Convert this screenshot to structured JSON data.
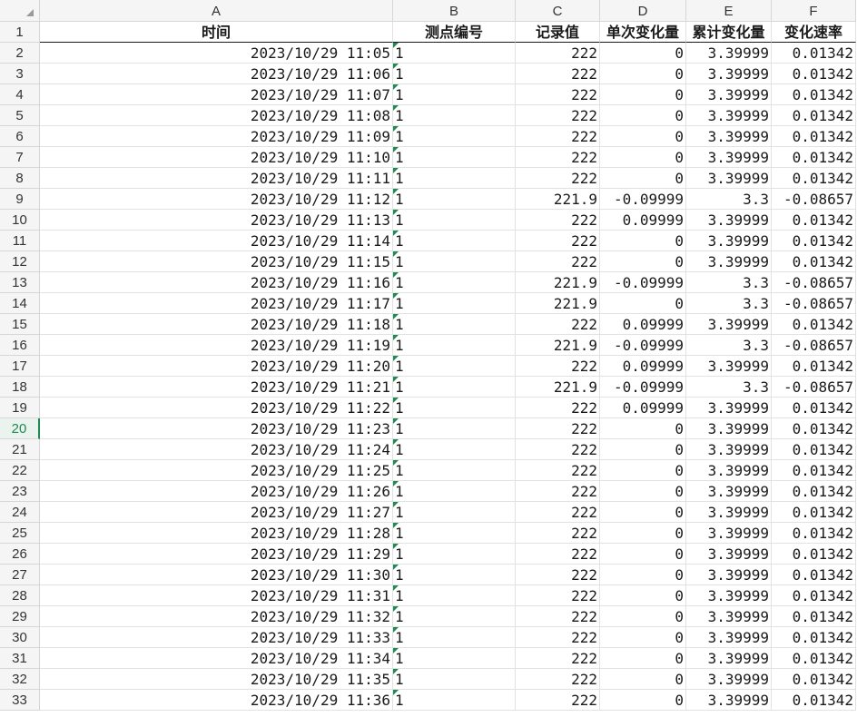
{
  "columns": [
    {
      "label": "A",
      "width": 389
    },
    {
      "label": "B",
      "width": 135
    },
    {
      "label": "C",
      "width": 93
    },
    {
      "label": "D",
      "width": 95
    },
    {
      "label": "E",
      "width": 94
    },
    {
      "label": "F",
      "width": 93
    }
  ],
  "active_row": 20,
  "header_row": [
    "时间",
    "测点编号",
    "记录值",
    "单次变化量",
    "累计变化量",
    "变化速率"
  ],
  "rows": [
    [
      "2023/10/29 11:05",
      "1",
      "222",
      "0",
      "3.39999",
      "0.01342"
    ],
    [
      "2023/10/29 11:06",
      "1",
      "222",
      "0",
      "3.39999",
      "0.01342"
    ],
    [
      "2023/10/29 11:07",
      "1",
      "222",
      "0",
      "3.39999",
      "0.01342"
    ],
    [
      "2023/10/29 11:08",
      "1",
      "222",
      "0",
      "3.39999",
      "0.01342"
    ],
    [
      "2023/10/29 11:09",
      "1",
      "222",
      "0",
      "3.39999",
      "0.01342"
    ],
    [
      "2023/10/29 11:10",
      "1",
      "222",
      "0",
      "3.39999",
      "0.01342"
    ],
    [
      "2023/10/29 11:11",
      "1",
      "222",
      "0",
      "3.39999",
      "0.01342"
    ],
    [
      "2023/10/29 11:12",
      "1",
      "221.9",
      "-0.09999",
      "3.3",
      "-0.08657"
    ],
    [
      "2023/10/29 11:13",
      "1",
      "222",
      "0.09999",
      "3.39999",
      "0.01342"
    ],
    [
      "2023/10/29 11:14",
      "1",
      "222",
      "0",
      "3.39999",
      "0.01342"
    ],
    [
      "2023/10/29 11:15",
      "1",
      "222",
      "0",
      "3.39999",
      "0.01342"
    ],
    [
      "2023/10/29 11:16",
      "1",
      "221.9",
      "-0.09999",
      "3.3",
      "-0.08657"
    ],
    [
      "2023/10/29 11:17",
      "1",
      "221.9",
      "0",
      "3.3",
      "-0.08657"
    ],
    [
      "2023/10/29 11:18",
      "1",
      "222",
      "0.09999",
      "3.39999",
      "0.01342"
    ],
    [
      "2023/10/29 11:19",
      "1",
      "221.9",
      "-0.09999",
      "3.3",
      "-0.08657"
    ],
    [
      "2023/10/29 11:20",
      "1",
      "222",
      "0.09999",
      "3.39999",
      "0.01342"
    ],
    [
      "2023/10/29 11:21",
      "1",
      "221.9",
      "-0.09999",
      "3.3",
      "-0.08657"
    ],
    [
      "2023/10/29 11:22",
      "1",
      "222",
      "0.09999",
      "3.39999",
      "0.01342"
    ],
    [
      "2023/10/29 11:23",
      "1",
      "222",
      "0",
      "3.39999",
      "0.01342"
    ],
    [
      "2023/10/29 11:24",
      "1",
      "222",
      "0",
      "3.39999",
      "0.01342"
    ],
    [
      "2023/10/29 11:25",
      "1",
      "222",
      "0",
      "3.39999",
      "0.01342"
    ],
    [
      "2023/10/29 11:26",
      "1",
      "222",
      "0",
      "3.39999",
      "0.01342"
    ],
    [
      "2023/10/29 11:27",
      "1",
      "222",
      "0",
      "3.39999",
      "0.01342"
    ],
    [
      "2023/10/29 11:28",
      "1",
      "222",
      "0",
      "3.39999",
      "0.01342"
    ],
    [
      "2023/10/29 11:29",
      "1",
      "222",
      "0",
      "3.39999",
      "0.01342"
    ],
    [
      "2023/10/29 11:30",
      "1",
      "222",
      "0",
      "3.39999",
      "0.01342"
    ],
    [
      "2023/10/29 11:31",
      "1",
      "222",
      "0",
      "3.39999",
      "0.01342"
    ],
    [
      "2023/10/29 11:32",
      "1",
      "222",
      "0",
      "3.39999",
      "0.01342"
    ],
    [
      "2023/10/29 11:33",
      "1",
      "222",
      "0",
      "3.39999",
      "0.01342"
    ],
    [
      "2023/10/29 11:34",
      "1",
      "222",
      "0",
      "3.39999",
      "0.01342"
    ],
    [
      "2023/10/29 11:35",
      "1",
      "222",
      "0",
      "3.39999",
      "0.01342"
    ],
    [
      "2023/10/29 11:36",
      "1",
      "222",
      "0",
      "3.39999",
      "0.01342"
    ]
  ],
  "colors": {
    "accent": "#1e8a55",
    "header_bg": "#f5f5f5",
    "grid_line": "#e2e2e2"
  }
}
